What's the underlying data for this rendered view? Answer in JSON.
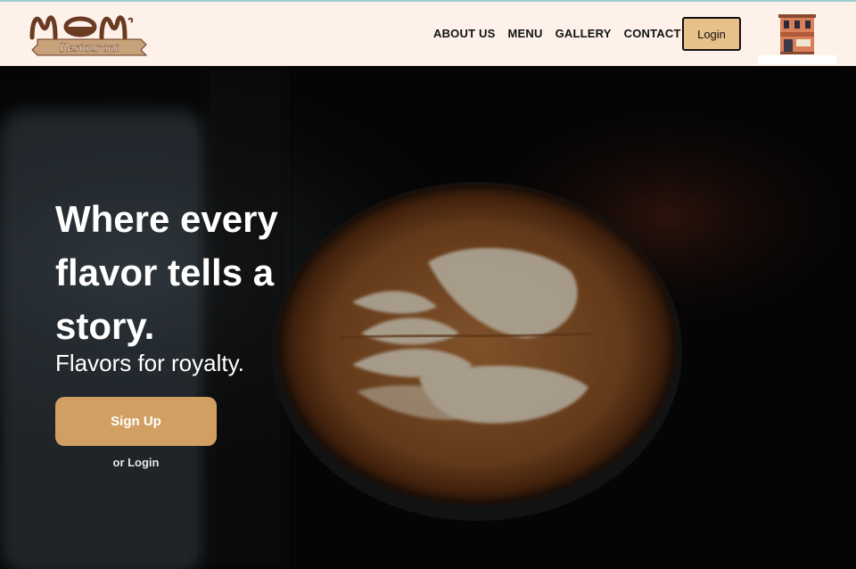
{
  "brand": {
    "logo_text": "Mom",
    "logo_ribbon": "Restaurant",
    "colors": {
      "accent": "#d29f63",
      "login_bg": "#e8c08a",
      "nav_bg": "#fdf1ea",
      "logo_brown": "#6b3a22"
    }
  },
  "nav": {
    "links": [
      "ABOUT US",
      "MENU",
      "GALLERY",
      "CONTACT US"
    ],
    "login_label": "Login",
    "shop_icon": "storefront-icon"
  },
  "hero": {
    "headline": "Where every flavor tells a story.",
    "tagline": "Flavors for royalty.",
    "signup_label": "Sign Up",
    "or_login_label": "or Login",
    "background": "latte-art-coffee-cup"
  }
}
